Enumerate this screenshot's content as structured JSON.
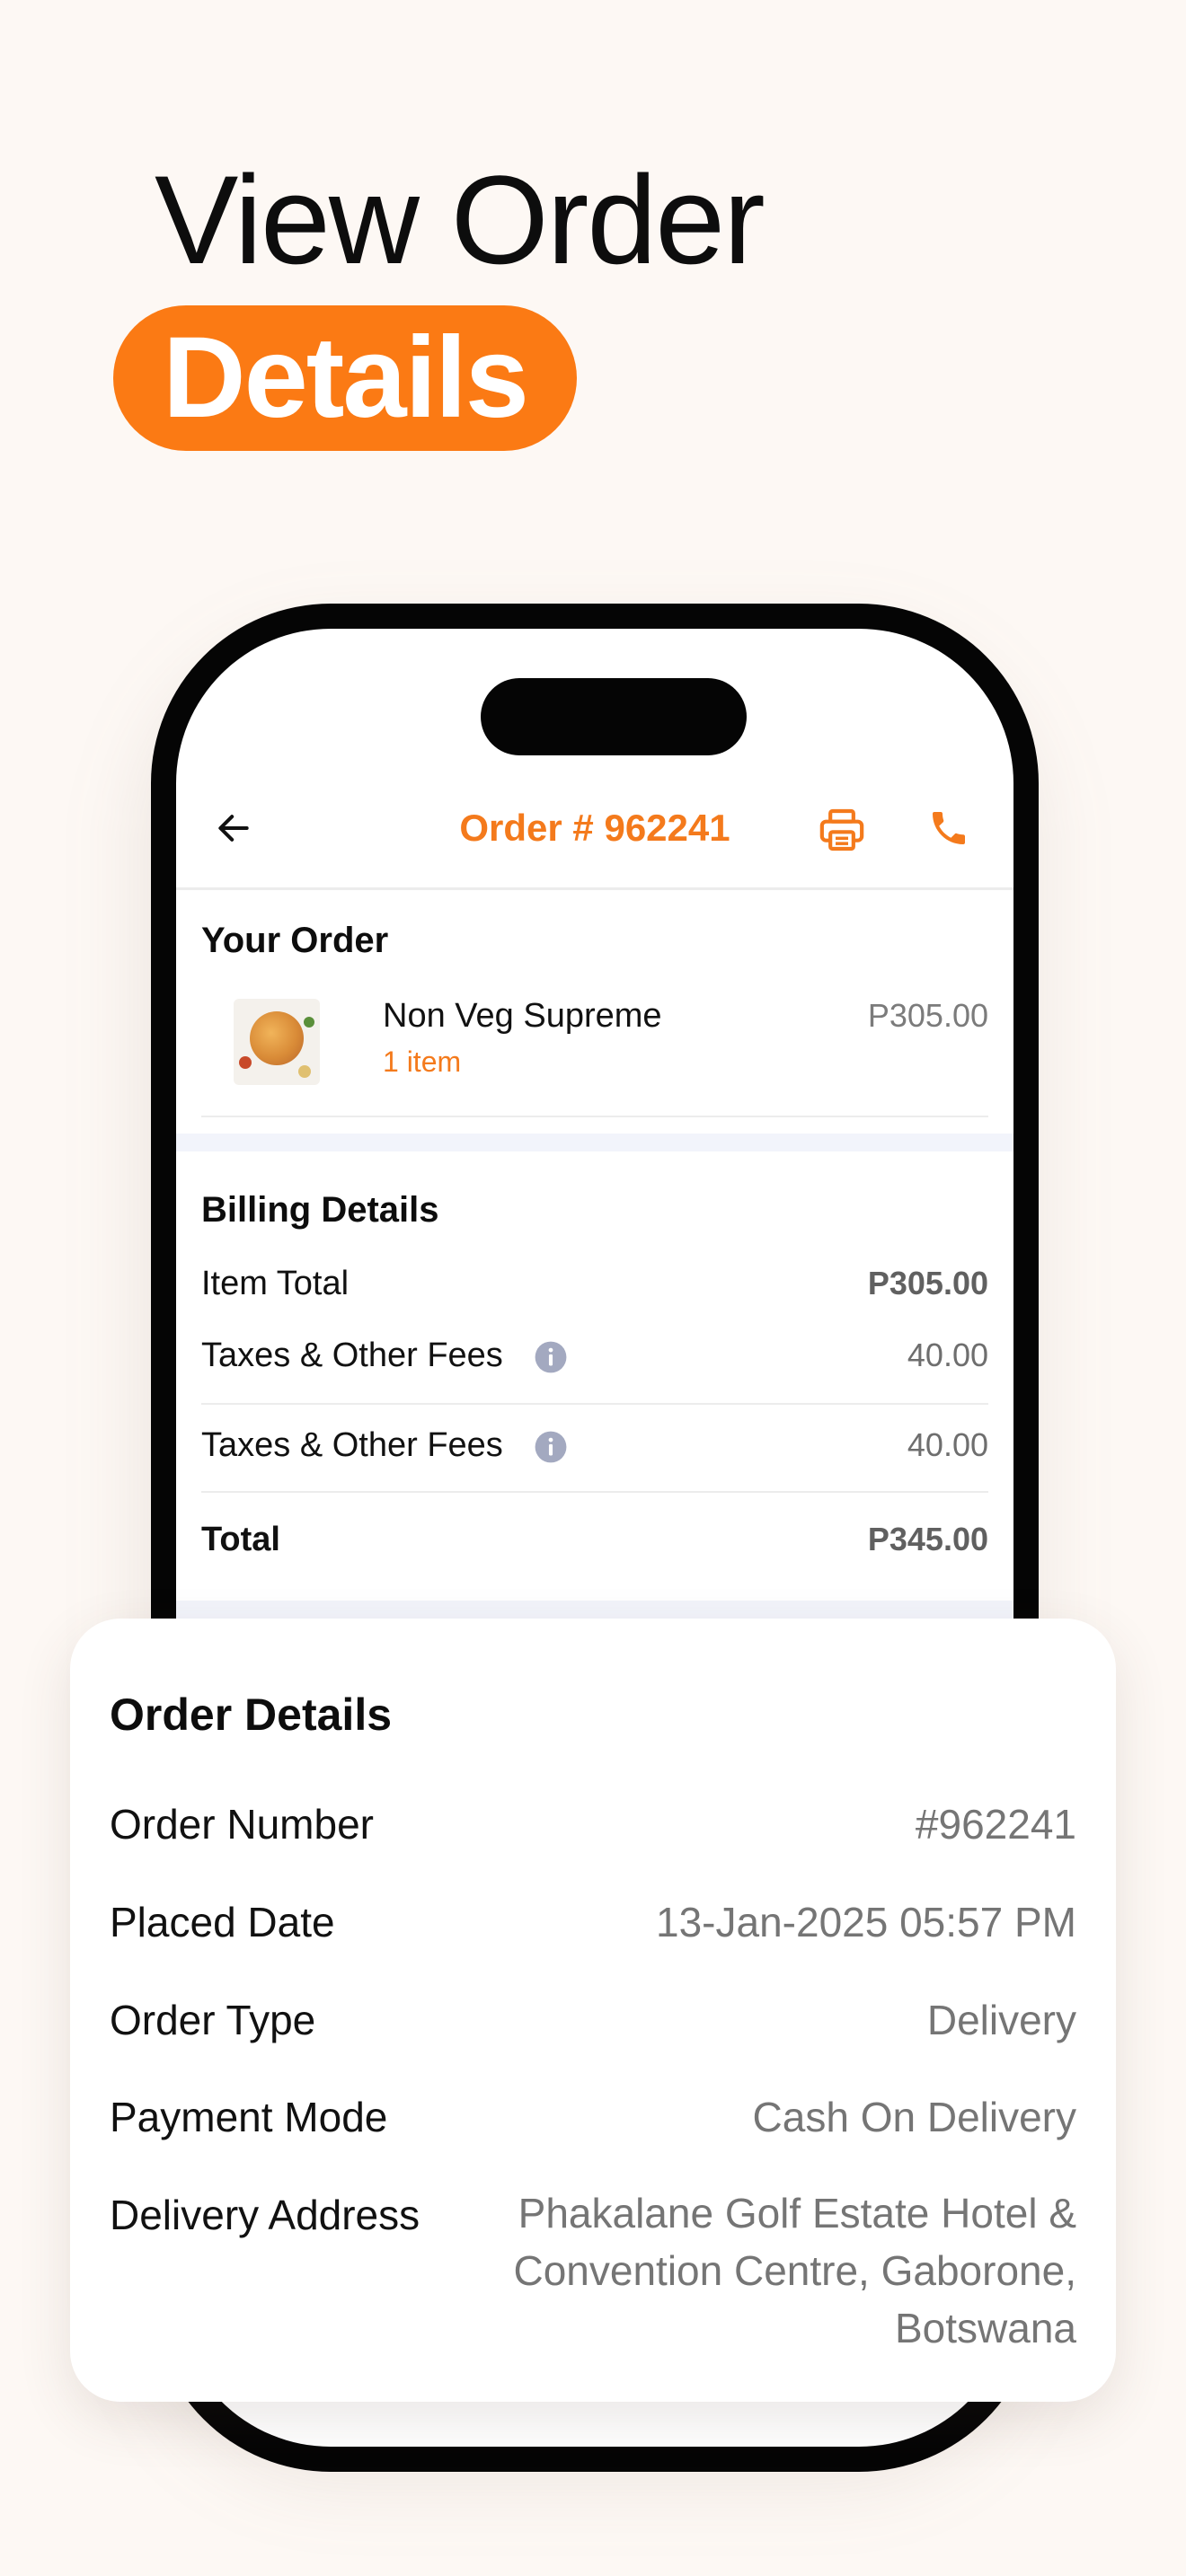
{
  "hero": {
    "line1": "View Order",
    "line2": "Details"
  },
  "app": {
    "title": "Order # 962241",
    "your_order": {
      "heading": "Your Order",
      "item_name": "Non Veg Supreme",
      "item_qty": "1 item",
      "item_price": "P305.00"
    },
    "billing": {
      "heading": "Billing Details",
      "rows": [
        {
          "label": "Item Total",
          "value": "P305.00"
        },
        {
          "label": "Taxes & Other Fees",
          "value": "40.00"
        },
        {
          "label": "Taxes & Other Fees",
          "value": "40.00"
        },
        {
          "label": "Total",
          "value": "P345.00"
        }
      ]
    }
  },
  "order_details": {
    "heading": "Order Details",
    "rows": [
      {
        "label": "Order Number",
        "value": "#962241"
      },
      {
        "label": "Placed Date",
        "value": "13-Jan-2025 05:57 PM"
      },
      {
        "label": "Order Type",
        "value": "Delivery"
      },
      {
        "label": "Payment Mode",
        "value": "Cash On Delivery"
      },
      {
        "label": "Delivery Address",
        "value": "Phakalane Golf Estate Hotel & Convention Centre, Gaborone, Botswana"
      }
    ]
  },
  "colors": {
    "accent": "#f47a1c",
    "pill": "#fb7a14",
    "background": "#fdf8f4",
    "info_icon": "#a3a9c0"
  },
  "icons": {
    "back": "arrow-left-icon",
    "print": "printer-icon",
    "call": "phone-icon",
    "info": "info-icon"
  }
}
